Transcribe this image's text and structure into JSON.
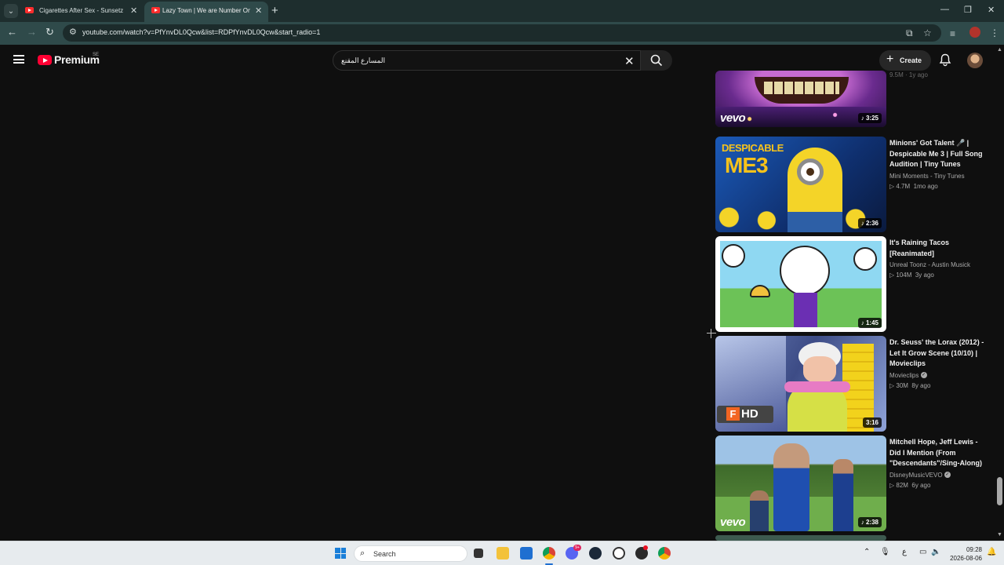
{
  "browser": {
    "tabs": [
      {
        "title": "Cigarettes After Sex - Sunsetz",
        "active": false
      },
      {
        "title": "Lazy Town | We are Number One",
        "active": true
      }
    ],
    "url": "youtube.com/watch?v=PfYnvDL0Qcw&list=RDPfYnvDL0Qcw&start_radio=1"
  },
  "masthead": {
    "logo": "Premium",
    "country": "SE",
    "search_query": "المسارع المقنع",
    "create_label": "Create"
  },
  "recommendations": [
    {
      "title": "",
      "duration": "3:25",
      "vevo": "vevo",
      "partial_meta": "9.5M · 1y ago"
    },
    {
      "title": "Minions' Got Talent 🎤 | Despicable Me 3 | Full Song Audition | Tiny Tunes",
      "channel": "Mini Moments - Tiny Tunes",
      "views": "4.7M",
      "age": "1mo ago",
      "duration": "2:36",
      "verified": false
    },
    {
      "title": "It's Raining Tacos [Reanimated]",
      "channel": "Unreal Toonz - Austin Musick",
      "views": "104M",
      "age": "3y ago",
      "duration": "1:45",
      "verified": false
    },
    {
      "title": "Dr. Seuss' the Lorax (2012) - Let It Grow Scene (10/10) | Movieclips",
      "channel": "Movieclips",
      "views": "30M",
      "age": "8y ago",
      "duration": "3:16",
      "verified": true,
      "badge": "HD"
    },
    {
      "title": "Mitchell Hope, Jeff Lewis - Did I Mention (From \"Descendants\"/Sing-Along)",
      "channel": "DisneyMusicVEVO",
      "views": "82M",
      "age": "6y ago",
      "duration": "2:38",
      "verified": true,
      "vevo": "vevo"
    }
  ],
  "thumb_text": {
    "despicable": "DESPICABLE",
    "me3": "ME3"
  },
  "taskbar": {
    "search_placeholder": "Search",
    "time": "09:28",
    "date": "2026-08-06",
    "lang": "ع",
    "chat_badge": "9+"
  },
  "colors": {
    "yt_red": "#ff0033",
    "bg": "#0f0f0f",
    "chrome_frame": "#1e2e2e",
    "chrome_toolbar": "#2f4a4a"
  }
}
